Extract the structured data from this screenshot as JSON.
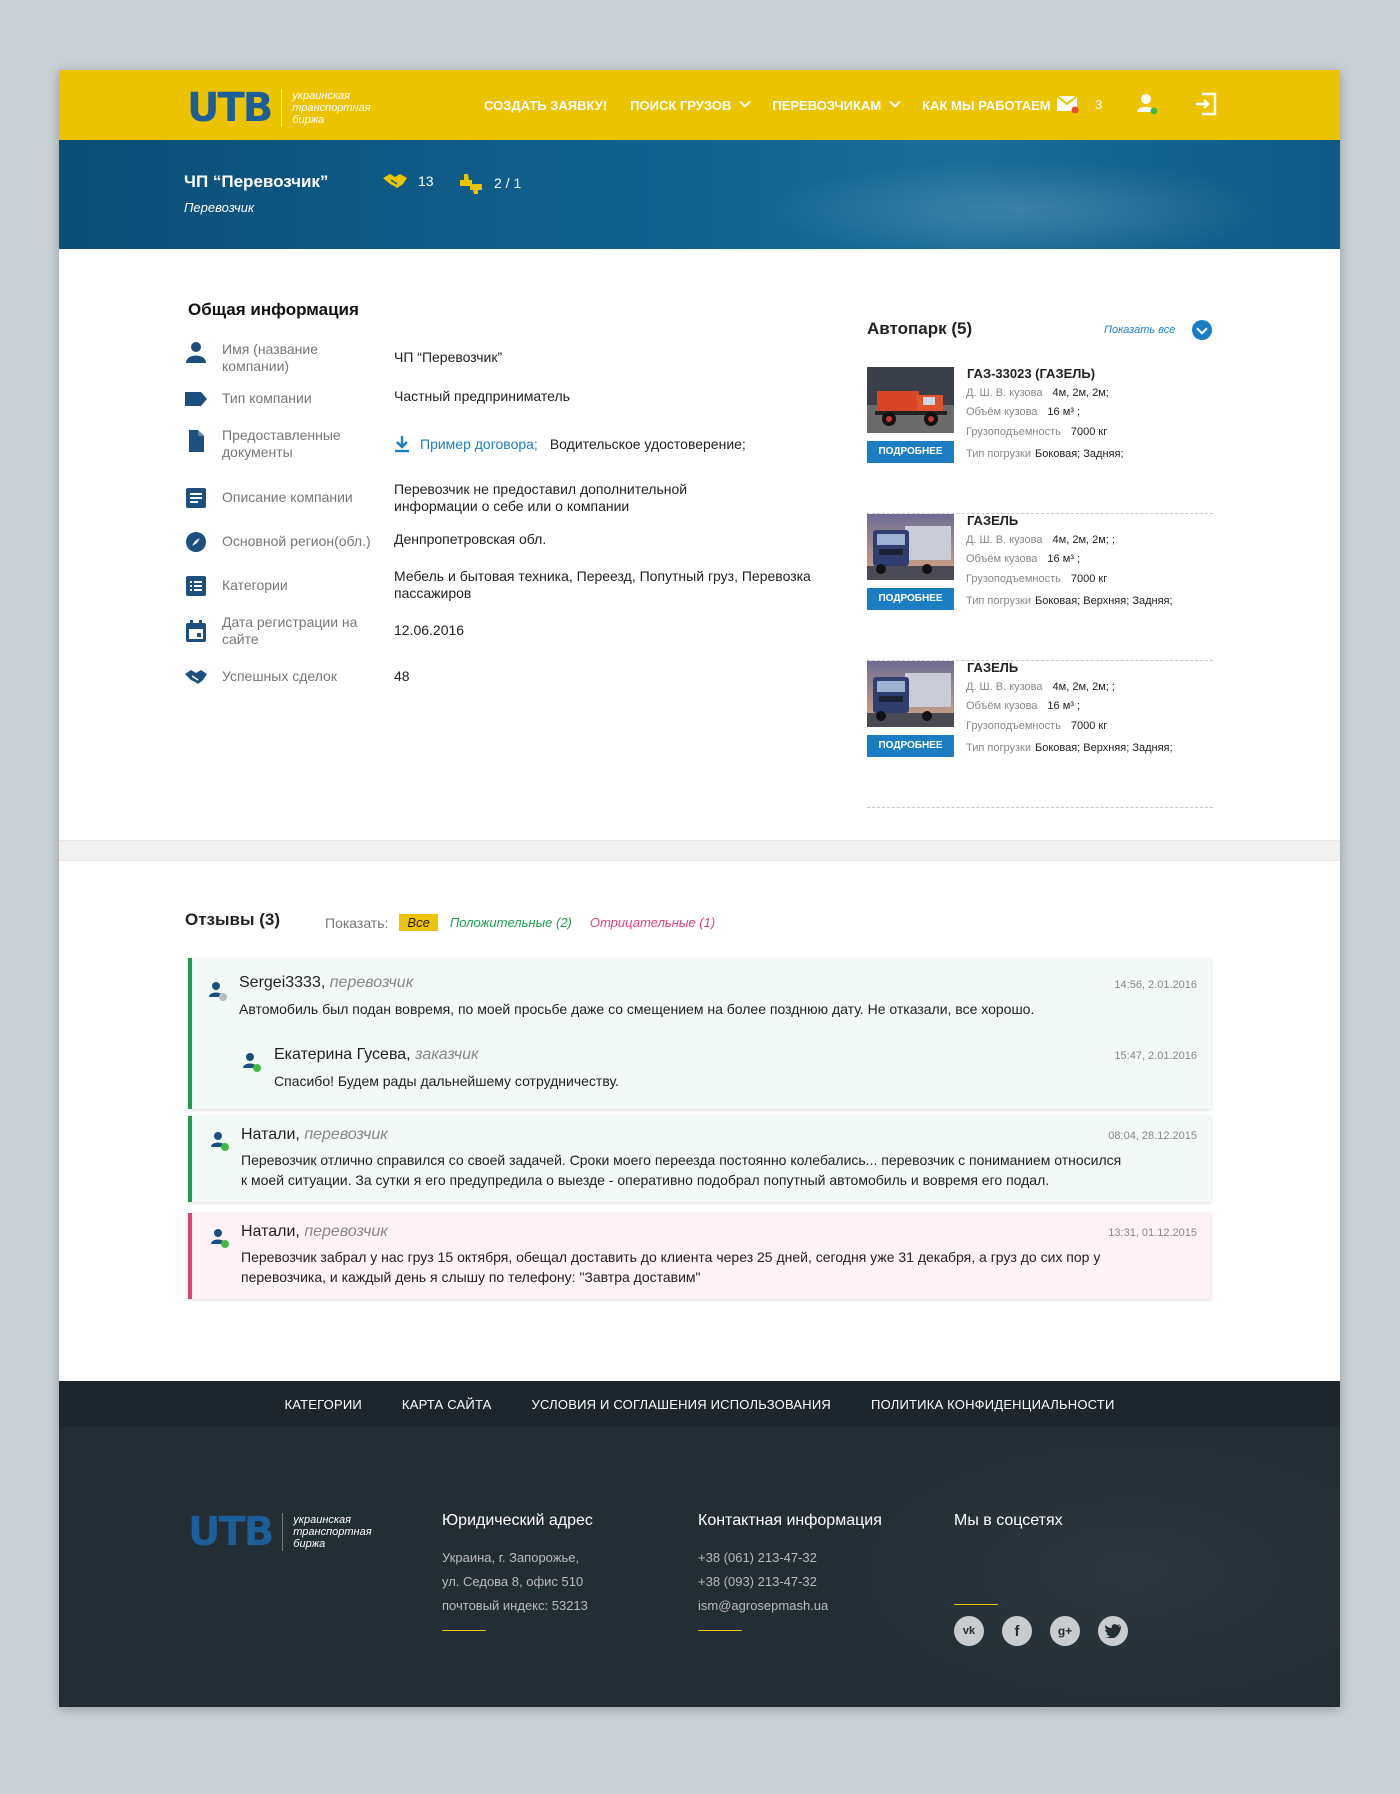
{
  "header": {
    "logo_text": "UTB",
    "logo_tagline_1": "украинская",
    "logo_tagline_2": "транспортная",
    "logo_tagline_3": "биржа",
    "nav": [
      "СОЗДАТЬ ЗАЯВКУ!",
      "ПОИСК ГРУЗОВ",
      "ПЕРЕВОЗЧИКАМ",
      "КАК МЫ РАБОТАЕМ"
    ],
    "mail_count": "3",
    "icons": [
      "mail-icon",
      "user-icon",
      "logout-icon"
    ]
  },
  "profile": {
    "name": "ЧП “Перевозчик”",
    "role": "Перевозчик",
    "deals": "13",
    "rating": "2 / 1"
  },
  "general": {
    "title": "Общая информация",
    "rows": [
      {
        "label": "Имя (название компании)",
        "value": "ЧП “Перевозчик”",
        "icon": "person-icon"
      },
      {
        "label": "Тип компании",
        "value": "Частный предприниматель",
        "icon": "tag-icon"
      },
      {
        "label": "Предоставленные документы",
        "link": "Пример договора;",
        "value": "Водительское удостоверение;",
        "icon": "document-icon"
      },
      {
        "label": "Описание компании",
        "value": "Перевозчик не предоставил дополнительной информации о себе или о компании",
        "icon": "description-icon"
      },
      {
        "label": "Основной регион(обл.)",
        "value": "Денпропетровская обл.",
        "icon": "compass-icon"
      },
      {
        "label": "Категории",
        "value": "Мебель и бытовая техника, Переезд, Попутный груз, Перевозка пассажиров",
        "icon": "list-icon"
      },
      {
        "label": "Дата регистрации на сайте",
        "value": "12.06.2016",
        "icon": "calendar-icon"
      },
      {
        "label": "Успешных сделок",
        "value": "48",
        "icon": "handshake-icon"
      }
    ]
  },
  "fleet": {
    "title": "Автопарк (5)",
    "show_all": "Показать все",
    "more_label": "ПОДРОБНЕЕ",
    "spec_labels": [
      "Д. Ш. В. кузова",
      "Объём кузова",
      "Грузоподъемность",
      "Тип погрузки"
    ],
    "trucks": [
      {
        "name": "ГАЗ-33023 (ГАЗЕЛЬ)",
        "dims": "4м, 2м, 2м;",
        "volume": "16 м³ ;",
        "capacity": "7000 кг",
        "loading": "Боковая; Задняя;"
      },
      {
        "name": "ГАЗЕЛЬ",
        "dims": "4м, 2м, 2м; ;",
        "volume": "16 м³ ;",
        "capacity": "7000 кг",
        "loading": "Боковая; Верхняя; Задняя;"
      },
      {
        "name": "ГАЗЕЛЬ",
        "dims": "4м, 2м, 2м; ;",
        "volume": "16 м³ ;",
        "capacity": "7000 кг",
        "loading": "Боковая; Верхняя; Задняя;"
      }
    ]
  },
  "reviews": {
    "title": "Отзывы (3)",
    "show_label": "Показать:",
    "filter_all": "Все",
    "filter_pos": "Положительные (2)",
    "filter_neg": "Отрицательные (1)",
    "items": [
      {
        "author": "Sergei3333,",
        "role": "перевозчик",
        "date": "14:56, 2.01.2016",
        "text": "Автомобиль был подан вовремя, по моей просьбе даже со смещением на более позднюю дату. Не отказали, все хорошо.",
        "reply": {
          "author": "Екатерина Гусева,",
          "role": "заказчик",
          "date": "15:47, 2.01.2016",
          "text": "Спасибо! Будем рады дальнейшему сотрудничеству."
        }
      },
      {
        "author": "Натали,",
        "role": "перевозчик",
        "date": "08:04, 28.12.2015",
        "text_1": "Перевозчик отлично справился со своей задачей. Сроки моего переезда постоянно колебались... перевозчик с пониманием относился",
        "text_2": "к моей ситуации. За сутки я его предупредила о выезде - оперативно подобрал попутный автомобиль и вовремя его подал."
      },
      {
        "author": "Натали,",
        "role": "перевозчик",
        "date": "13:31, 01.12.2015",
        "text_1": "Перевозчик забрал у нас груз 15 октября, обещал доставить до клиента через 25 дней, сегодня уже 31 декабря, а груз до сих пор у",
        "text_2": "перевозчика, и каждый день я слышу по телефону: \"Завтра доставим\""
      }
    ]
  },
  "footer": {
    "links": [
      "КАТЕГОРИИ",
      "КАРТА САЙТА",
      "УСЛОВИЯ И СОГЛАШЕНИЯ ИСПОЛЬЗОВАНИЯ",
      "ПОЛИТИКА КОНФИДЕНЦИАЛЬНОСТИ"
    ],
    "address_title": "Юридический  адрес",
    "address": [
      "Украина, г. Запорожье,",
      "ул. Седова 8, офис 510",
      "почтовый индекс: 53213"
    ],
    "contacts_title": "Контактная информация",
    "contacts": [
      "+38 (061) 213-47-32",
      "+38 (093) 213-47-32",
      "ism@agrosepmash.ua"
    ],
    "social_title": "Мы в соцсетях",
    "social": [
      "vk-icon",
      "facebook-icon",
      "googleplus-icon",
      "twitter-icon"
    ],
    "accent_color": "#ecc300"
  },
  "colors": {
    "brand_yellow": "#ecc300",
    "brand_blue": "#1b5e9a",
    "link_blue": "#1c7ec2",
    "positive": "#1b9e4e",
    "negative": "#e0437a"
  }
}
